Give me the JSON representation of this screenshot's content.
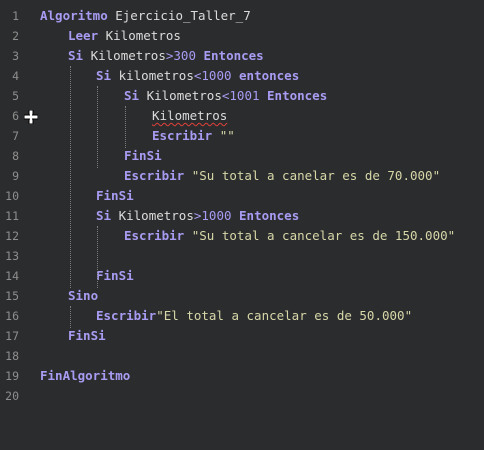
{
  "editor": {
    "lines": [
      {
        "number": "1",
        "parts": [
          {
            "text": "Algoritmo",
            "kind": "kw"
          },
          {
            "text": " Ejercicio_Taller_7",
            "kind": "id"
          }
        ]
      },
      {
        "number": "2",
        "parts": [
          {
            "text": "Leer",
            "kind": "kw"
          },
          {
            "text": " Kilometros",
            "kind": "id"
          }
        ]
      },
      {
        "number": "3",
        "parts": [
          {
            "text": "Si",
            "kind": "kw"
          },
          {
            "text": " Kilometros",
            "kind": "id"
          },
          {
            "text": ">",
            "kind": "op"
          },
          {
            "text": "300",
            "kind": "num"
          },
          {
            "text": " ",
            "kind": "id"
          },
          {
            "text": "Entonces",
            "kind": "kw"
          }
        ]
      },
      {
        "number": "4",
        "parts": [
          {
            "text": "Si",
            "kind": "kw"
          },
          {
            "text": " kilometros",
            "kind": "id"
          },
          {
            "text": "<",
            "kind": "op"
          },
          {
            "text": "1000",
            "kind": "num"
          },
          {
            "text": " ",
            "kind": "id"
          },
          {
            "text": "entonces",
            "kind": "kw"
          }
        ]
      },
      {
        "number": "5",
        "parts": [
          {
            "text": "Si",
            "kind": "kw"
          },
          {
            "text": " Kilometros",
            "kind": "id"
          },
          {
            "text": "<",
            "kind": "op"
          },
          {
            "text": "1001",
            "kind": "num"
          },
          {
            "text": " ",
            "kind": "id"
          },
          {
            "text": "Entonces",
            "kind": "kw"
          }
        ]
      },
      {
        "number": "6",
        "parts": [
          {
            "text": "Kilometros",
            "kind": "id spell"
          }
        ]
      },
      {
        "number": "7",
        "parts": [
          {
            "text": "Escribir",
            "kind": "kw"
          },
          {
            "text": " \"\"",
            "kind": "str"
          }
        ]
      },
      {
        "number": "8",
        "parts": [
          {
            "text": "FinSi",
            "kind": "kw"
          }
        ]
      },
      {
        "number": "9",
        "parts": [
          {
            "text": "Escribir",
            "kind": "kw"
          },
          {
            "text": " \"Su total a canelar es de 70.000\"",
            "kind": "str"
          }
        ]
      },
      {
        "number": "10",
        "parts": [
          {
            "text": "FinSi",
            "kind": "kw"
          }
        ]
      },
      {
        "number": "11",
        "parts": [
          {
            "text": "Si",
            "kind": "kw"
          },
          {
            "text": " Kilometros",
            "kind": "id"
          },
          {
            "text": ">",
            "kind": "op"
          },
          {
            "text": "1000",
            "kind": "num"
          },
          {
            "text": " ",
            "kind": "id"
          },
          {
            "text": "Entonces",
            "kind": "kw"
          }
        ]
      },
      {
        "number": "12",
        "parts": [
          {
            "text": "Escribir",
            "kind": "kw"
          },
          {
            "text": " \"Su total a cancelar es de 150.000\"",
            "kind": "str"
          }
        ]
      },
      {
        "number": "13",
        "parts": []
      },
      {
        "number": "14",
        "parts": [
          {
            "text": "FinSi",
            "kind": "kw"
          }
        ]
      },
      {
        "number": "15",
        "parts": [
          {
            "text": "Sino",
            "kind": "kw"
          }
        ]
      },
      {
        "number": "16",
        "parts": [
          {
            "text": "Escribir",
            "kind": "kw"
          },
          {
            "text": "\"El total a cancelar es de 50.000\"",
            "kind": "str"
          }
        ]
      },
      {
        "number": "17",
        "parts": [
          {
            "text": "FinSi",
            "kind": "kw"
          }
        ]
      },
      {
        "number": "18",
        "parts": []
      },
      {
        "number": "19",
        "parts": [
          {
            "text": "FinAlgoritmo",
            "kind": "kw"
          }
        ]
      },
      {
        "number": "20",
        "parts": []
      }
    ]
  },
  "colors": {
    "background": "#2b2c2e",
    "keyword": "#a79cf2",
    "identifier": "#dcdcdc",
    "string": "#d7d7a8",
    "line_number": "#8e8e8e",
    "spell_underline": "#e0413a"
  },
  "icons": {
    "cursor": "crosshair-cursor-icon"
  }
}
